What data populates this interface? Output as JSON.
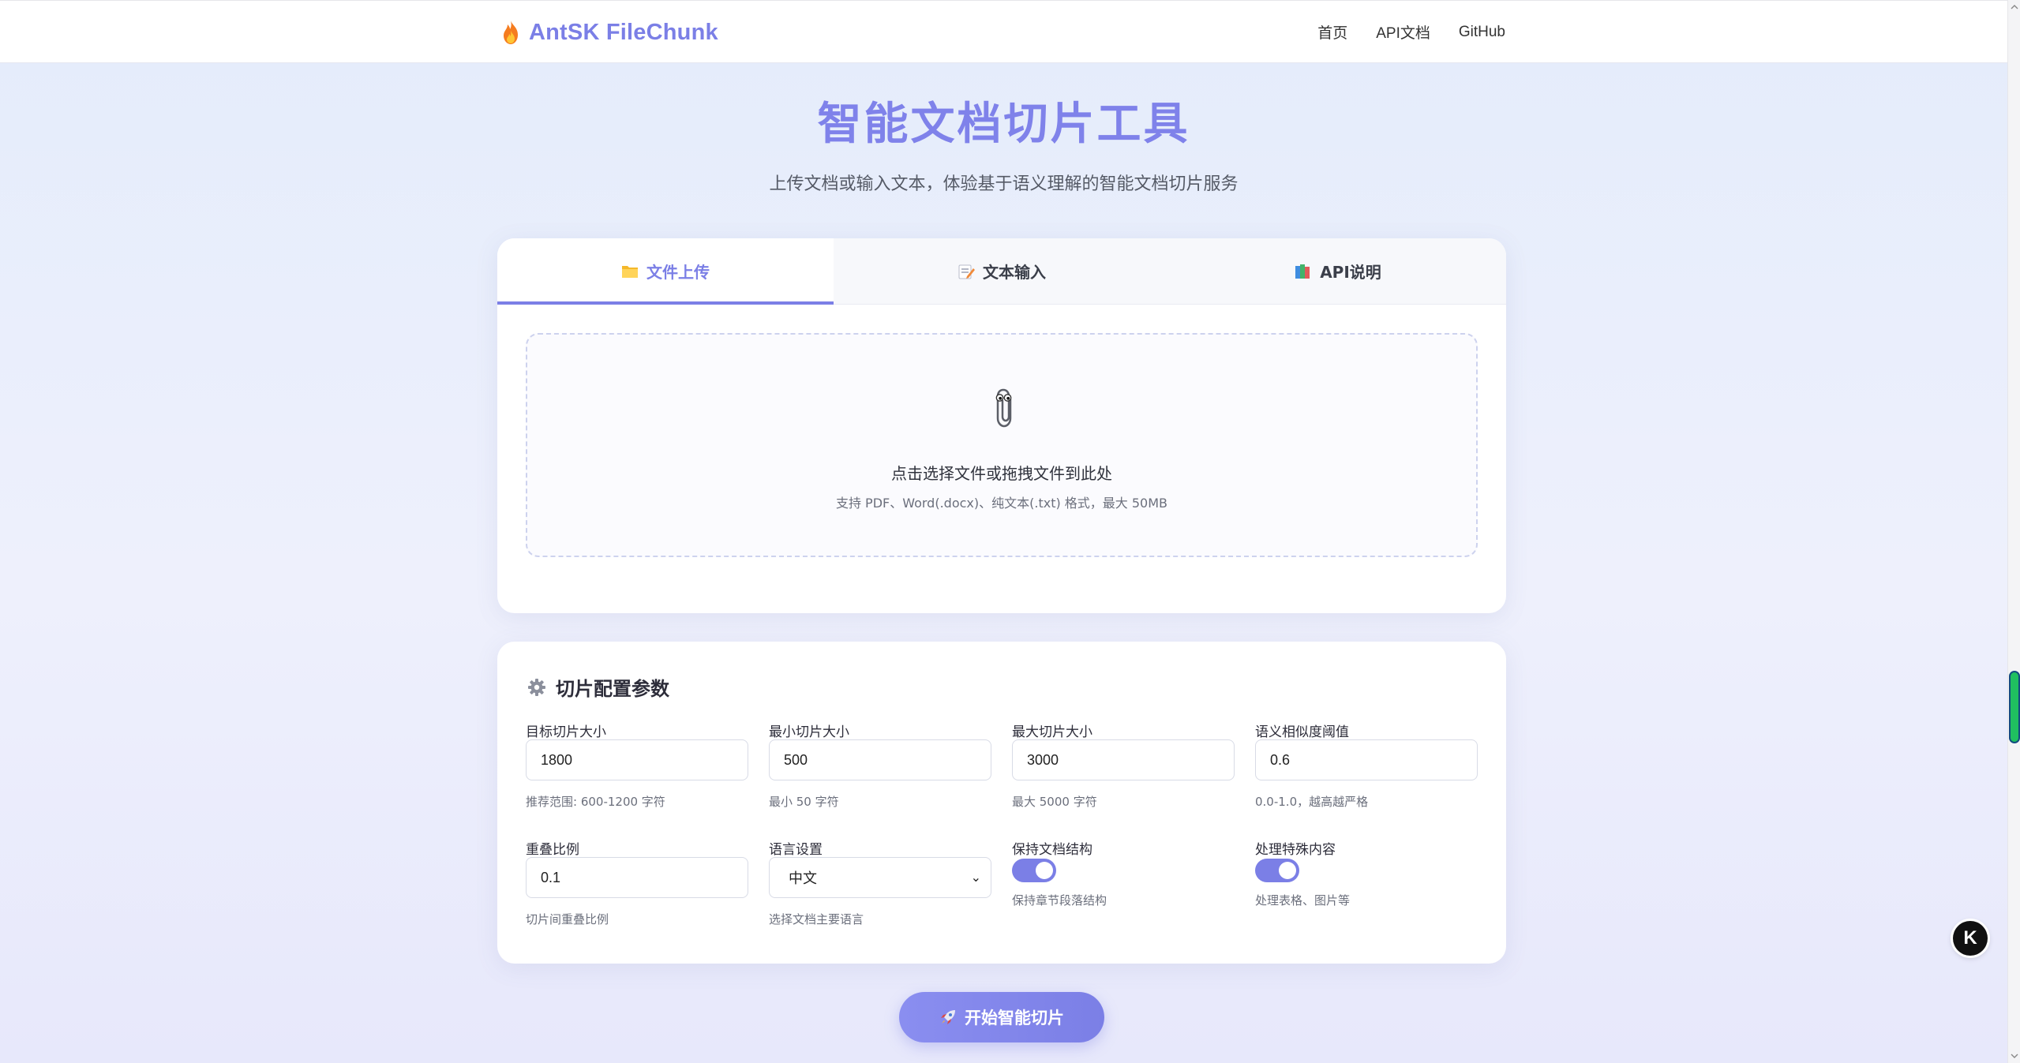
{
  "header": {
    "brand_name": "AntSK FileChunk",
    "nav": [
      "首页",
      "API文档",
      "GitHub"
    ]
  },
  "hero": {
    "title": "智能文档切片工具",
    "subtitle": "上传文档或输入文本，体验基于语义理解的智能文档切片服务"
  },
  "tabs": [
    {
      "label": "文件上传",
      "icon": "folder-icon",
      "active": true
    },
    {
      "label": "文本输入",
      "icon": "memo-icon",
      "active": false
    },
    {
      "label": "API说明",
      "icon": "books-icon",
      "active": false
    }
  ],
  "upload": {
    "icon": "paperclip-icon",
    "prompt": "点击选择文件或拖拽文件到此处",
    "hint": "支持 PDF、Word(.docx)、纯文本(.txt) 格式，最大 50MB"
  },
  "config": {
    "title": "切片配置参数",
    "fields": [
      {
        "label": "目标切片大小",
        "value": "1800",
        "help": "推荐范围: 600-1200 字符"
      },
      {
        "label": "最小切片大小",
        "value": "500",
        "help": "最小 50 字符"
      },
      {
        "label": "最大切片大小",
        "value": "3000",
        "help": "最大 5000 字符"
      },
      {
        "label": "语义相似度阈值",
        "value": "0.6",
        "help": "0.0-1.0，越高越严格"
      },
      {
        "label": "重叠比例",
        "value": "0.1",
        "help": "切片间重叠比例"
      },
      {
        "label": "语言设置",
        "value": "中文",
        "help": "选择文档主要语言"
      }
    ],
    "toggles": [
      {
        "label": "保持文档结构",
        "help": "保持章节段落结构",
        "on": true
      },
      {
        "label": "处理特殊内容",
        "help": "处理表格、图片等",
        "on": true
      }
    ]
  },
  "start_button": {
    "label": "开始智能切片",
    "icon": "rocket-icon"
  },
  "floating_button": {
    "label": "K"
  },
  "colors": {
    "accent": "#7b7fe6",
    "title": "#7f82ea",
    "scroll_thumb": "#20c060"
  }
}
